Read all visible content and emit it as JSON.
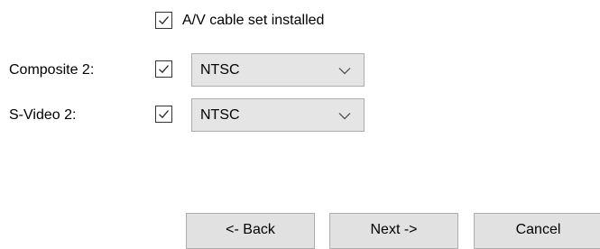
{
  "av_cable": {
    "label": "A/V cable set installed",
    "checked": true
  },
  "composite": {
    "label": "Composite 2:",
    "checked": true,
    "selected": "NTSC"
  },
  "svideo": {
    "label": "S-Video 2:",
    "checked": true,
    "selected": "NTSC"
  },
  "buttons": {
    "back": "<- Back",
    "next": "Next ->",
    "cancel": "Cancel"
  },
  "icons": {
    "check": "checkmark-icon",
    "dropdown": "chevron-down-icon"
  }
}
